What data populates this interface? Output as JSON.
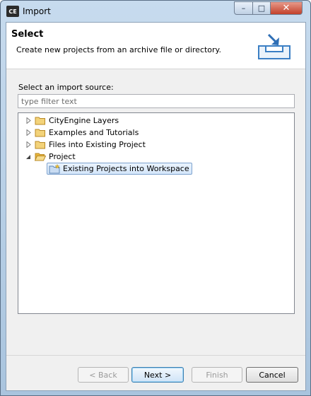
{
  "window": {
    "app_icon_text": "CE",
    "title": "Import",
    "minimize_glyph": "–",
    "maximize_glyph": "□",
    "close_glyph": "✕"
  },
  "banner": {
    "title": "Select",
    "description": "Create new projects from an archive file or directory.",
    "icon": "import-wizard-icon"
  },
  "source": {
    "label": "Select an import source:",
    "filter_placeholder": "type filter text",
    "filter_value": ""
  },
  "tree": {
    "items": [
      {
        "label": "CityEngine Layers",
        "expanded": false,
        "icon": "folder-icon"
      },
      {
        "label": "Examples and Tutorials",
        "expanded": false,
        "icon": "folder-icon"
      },
      {
        "label": "Files into Existing Project",
        "expanded": false,
        "icon": "folder-icon"
      },
      {
        "label": "Project",
        "expanded": true,
        "icon": "folder-icon",
        "children": [
          {
            "label": "Existing Projects into Workspace",
            "selected": true,
            "icon": "project-icon"
          }
        ]
      }
    ]
  },
  "buttons": {
    "back": "< Back",
    "next": "Next >",
    "finish": "Finish",
    "cancel": "Cancel"
  },
  "colors": {
    "title_bar": "#b9d1ea",
    "folder": "#e8b53c",
    "selection": "#d4e6fa",
    "close_button": "#c2412b"
  }
}
